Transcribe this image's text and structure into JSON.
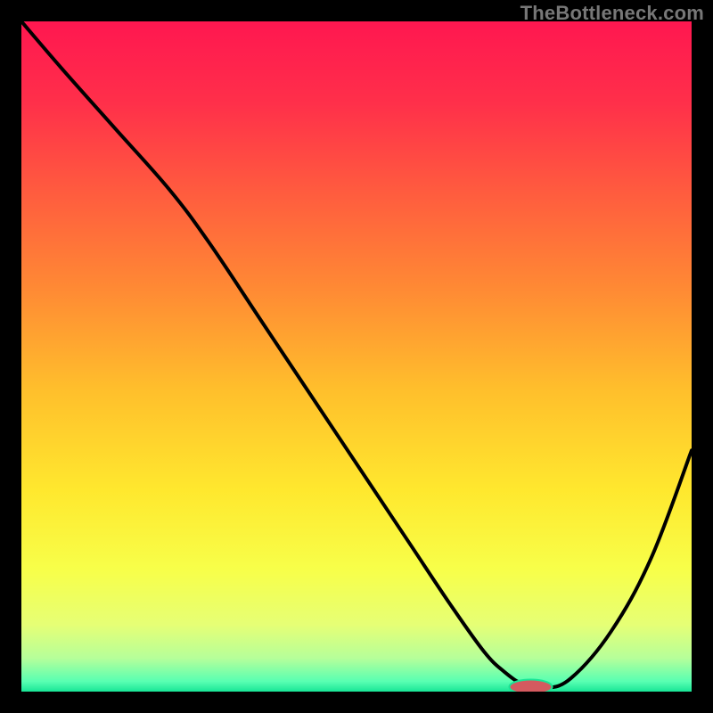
{
  "watermark": "TheBottleneck.com",
  "chart_data": {
    "type": "line",
    "title": "",
    "xlabel": "",
    "ylabel": "",
    "xlim": [
      0,
      100
    ],
    "ylim": [
      0,
      100
    ],
    "grid": false,
    "legend": false,
    "background_gradient": {
      "stops": [
        {
          "offset": 0.0,
          "color": "#ff1750"
        },
        {
          "offset": 0.12,
          "color": "#ff2f4a"
        },
        {
          "offset": 0.25,
          "color": "#ff5a3f"
        },
        {
          "offset": 0.4,
          "color": "#ff8a34"
        },
        {
          "offset": 0.55,
          "color": "#ffbf2c"
        },
        {
          "offset": 0.7,
          "color": "#ffe82e"
        },
        {
          "offset": 0.82,
          "color": "#f7ff4a"
        },
        {
          "offset": 0.9,
          "color": "#e6ff75"
        },
        {
          "offset": 0.95,
          "color": "#b6ff9a"
        },
        {
          "offset": 0.985,
          "color": "#58ffb2"
        },
        {
          "offset": 1.0,
          "color": "#18e596"
        }
      ]
    },
    "series": [
      {
        "name": "bottleneck-curve",
        "color": "#000000",
        "x": [
          0,
          6,
          14,
          22,
          28,
          36,
          44,
          52,
          58,
          64,
          69,
          72,
          75,
          78,
          82,
          88,
          94,
          100
        ],
        "y": [
          100,
          93,
          84,
          75,
          67,
          55,
          43,
          31,
          22,
          13,
          6,
          3,
          1,
          0.5,
          2,
          9,
          20,
          36
        ]
      }
    ],
    "marker": {
      "name": "optimal-point",
      "cx": 76,
      "cy": 0.7,
      "rx": 3.2,
      "ry": 1.1,
      "fill": "#d45a5f",
      "stroke": "#18e596"
    }
  }
}
